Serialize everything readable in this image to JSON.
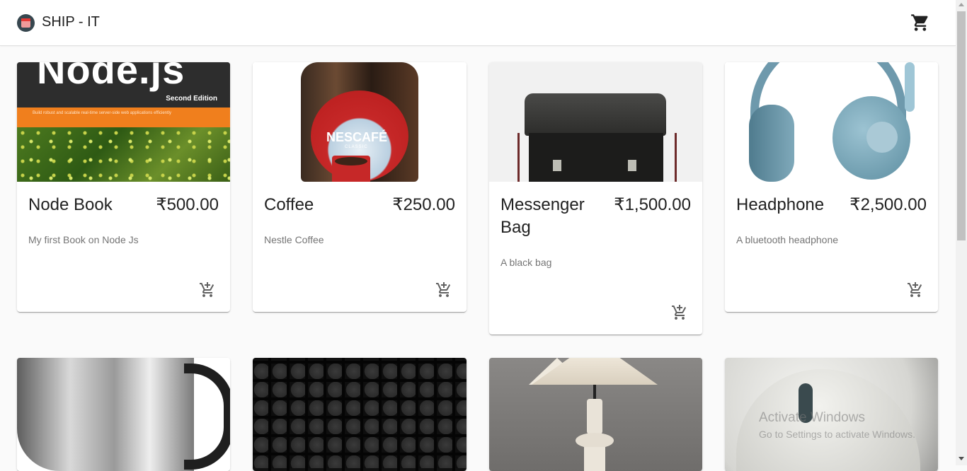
{
  "app": {
    "title": "SHIP - IT"
  },
  "header": {
    "logo_icon": "shop-logo-icon",
    "cart_icon": "shopping-cart-icon"
  },
  "products": [
    {
      "name": "Node Book",
      "price": "₹500.00",
      "description": "My first Book on Node Js",
      "image_text": "Node.js",
      "image_subtext": "Second Edition",
      "image_blurb": "Build robust and scalable real-time server-side web applications efficiently"
    },
    {
      "name": "Coffee",
      "price": "₹250.00",
      "description": "Nestle Coffee",
      "image_text": "NESCAFÉ",
      "image_subtext": "CLASSIC"
    },
    {
      "name": "Messenger Bag",
      "price": "₹1,500.00",
      "description": "A black bag"
    },
    {
      "name": "Headphone",
      "price": "₹2,500.00",
      "description": "A bluetooth headphone"
    }
  ],
  "add_to_cart_icon": "add-shopping-cart-icon",
  "second_row_images": [
    "kettle-image",
    "keyboard-image",
    "lamp-image",
    "mouse-image"
  ],
  "watermark": {
    "line1": "Activate Windows",
    "line2": "Go to Settings to activate Windows."
  }
}
